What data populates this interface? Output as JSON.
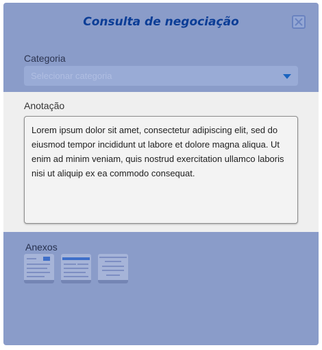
{
  "dialog": {
    "title": "Consulta de negociação",
    "close_icon": "close-x-icon"
  },
  "category": {
    "label": "Categoria",
    "placeholder": "Selecionar categoria",
    "caret_icon": "chevron-down-icon"
  },
  "note": {
    "label": "Anotação",
    "text": "Lorem ipsum dolor sit amet, consectetur adipiscing elit, sed do eiusmod tempor incididunt ut labore et dolore magna aliqua. Ut enim ad minim veniam, quis nostrud exercitation ullamco laboris nisi ut aliquip ex ea commodo consequat."
  },
  "attachments": {
    "label": "Anexos",
    "items": [
      "image-thumbnail",
      "image-thumbnail",
      "image-thumbnail"
    ]
  },
  "colors": {
    "overlay": "#8a9cc9",
    "title": "#0b3d96",
    "accent": "#1b64bf",
    "panel": "#efefef"
  }
}
